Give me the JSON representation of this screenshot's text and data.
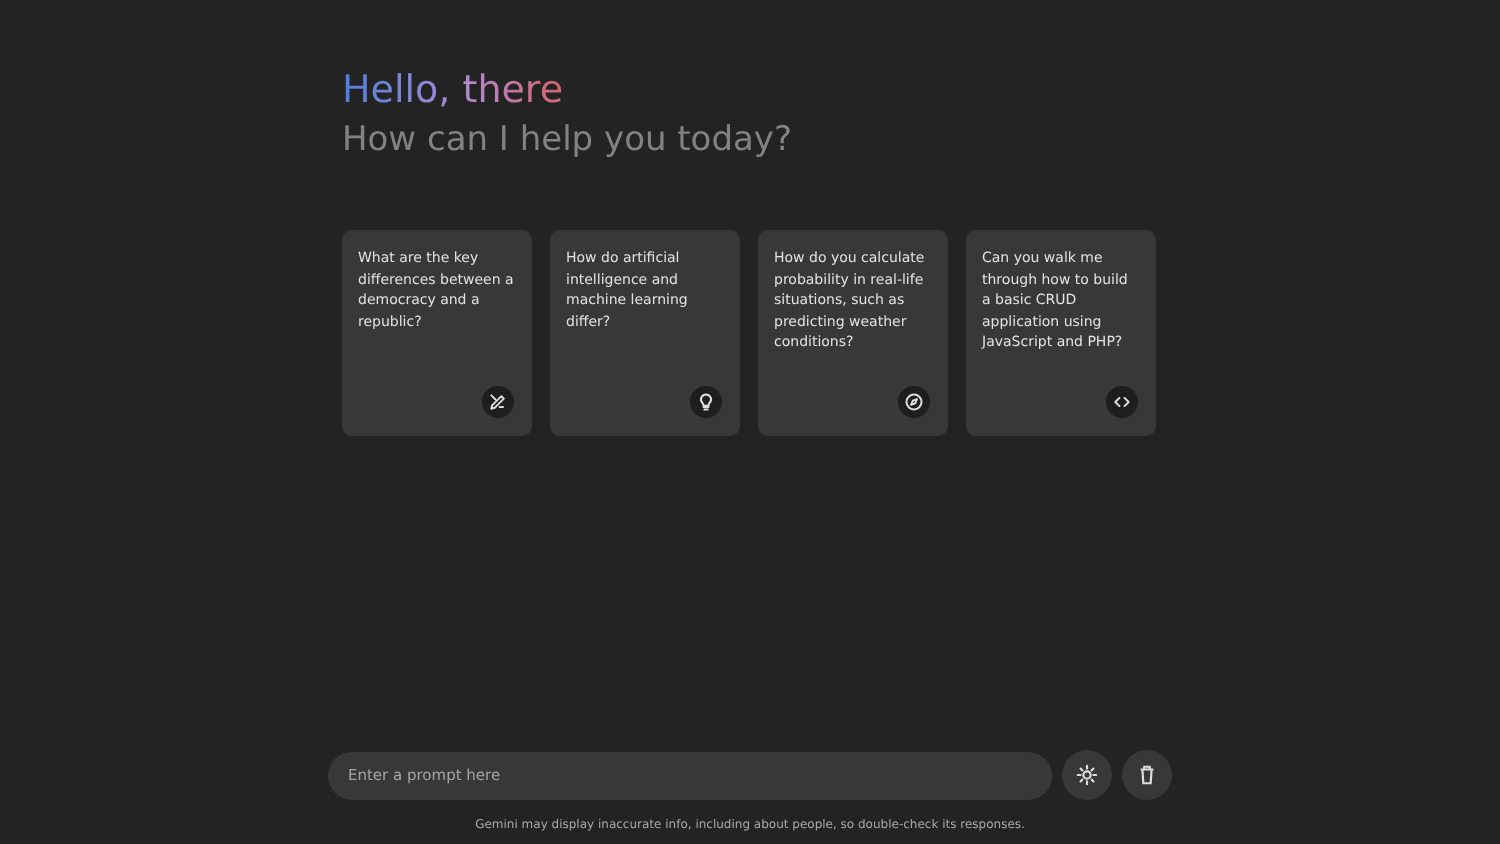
{
  "greeting": {
    "title": "Hello, there",
    "subtitle": "How can I help you today?"
  },
  "suggestions": [
    {
      "text": "What are the key differences between a democracy and a republic?",
      "kind": "pen"
    },
    {
      "text": "How do artificial intelligence and machine learning differ?",
      "kind": "bulb"
    },
    {
      "text": "How do you calculate probability in real-life situations, such as predicting weather conditions?",
      "kind": "compass"
    },
    {
      "text": "Can you walk me through how to build a basic CRUD application using JavaScript and PHP?",
      "kind": "code"
    }
  ],
  "prompt": {
    "placeholder": "Enter a prompt here"
  },
  "actions": [
    {
      "kind": "theme"
    },
    {
      "kind": "delete"
    }
  ],
  "disclaimer": "Gemini may display inaccurate info, including about people, so double-check its responses."
}
